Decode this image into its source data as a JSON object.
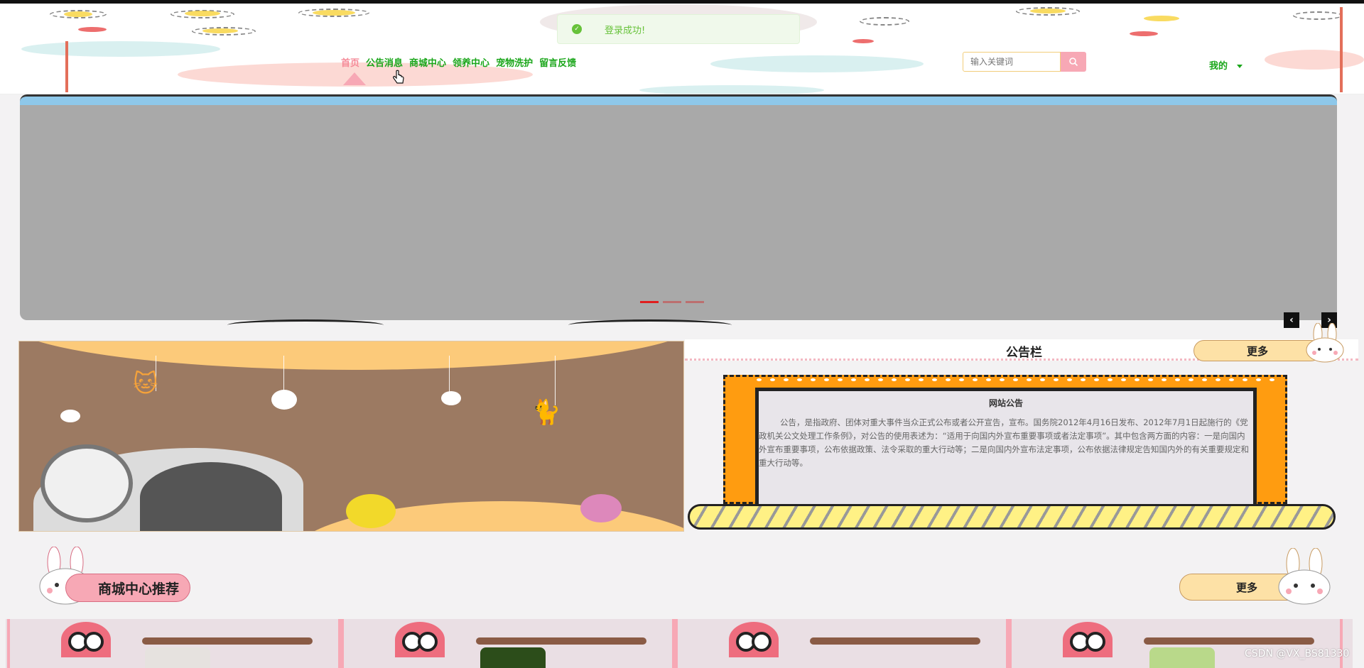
{
  "toast": {
    "message": "登录成功!",
    "color": "#67c23a"
  },
  "nav": {
    "items": [
      {
        "label": "首页",
        "active": true
      },
      {
        "label": "公告消息"
      },
      {
        "label": "商城中心"
      },
      {
        "label": "领养中心"
      },
      {
        "label": "宠物洗护"
      },
      {
        "label": "留言反馈"
      }
    ],
    "active_color": "#f58a98",
    "color": "#1aa61a"
  },
  "search": {
    "placeholder": "输入关键词",
    "button_icon": "search-icon"
  },
  "user_menu": {
    "label": "我的",
    "icon": "chevron-down-icon"
  },
  "carousel": {
    "slides": 3,
    "active_index": 0,
    "prev_icon": "chevron-left-icon",
    "next_icon": "chevron-right-icon"
  },
  "notice": {
    "title": "公告栏",
    "more_label": "更多",
    "board_title": "网站公告",
    "board_text": "公告，是指政府、团体对重大事件当众正式公布或者公开宣告，宣布。国务院2012年4月16日发布、2012年7月1日起施行的《党政机关公文处理工作条例》，对公告的使用表述为：“适用于向国内外宣布重要事项或者法定事项”。其中包含两方面的内容：一是向国内外宣布重要事项，公布依据政策、法令采取的重大行动等；二是向国内外宣布法定事项，公布依据法律规定告知国内外的有关重要规定和重大行动等。"
  },
  "shop": {
    "title": "商城中心推荐",
    "more_label": "更多"
  },
  "watermark": "CSDN @VX_BS81330"
}
